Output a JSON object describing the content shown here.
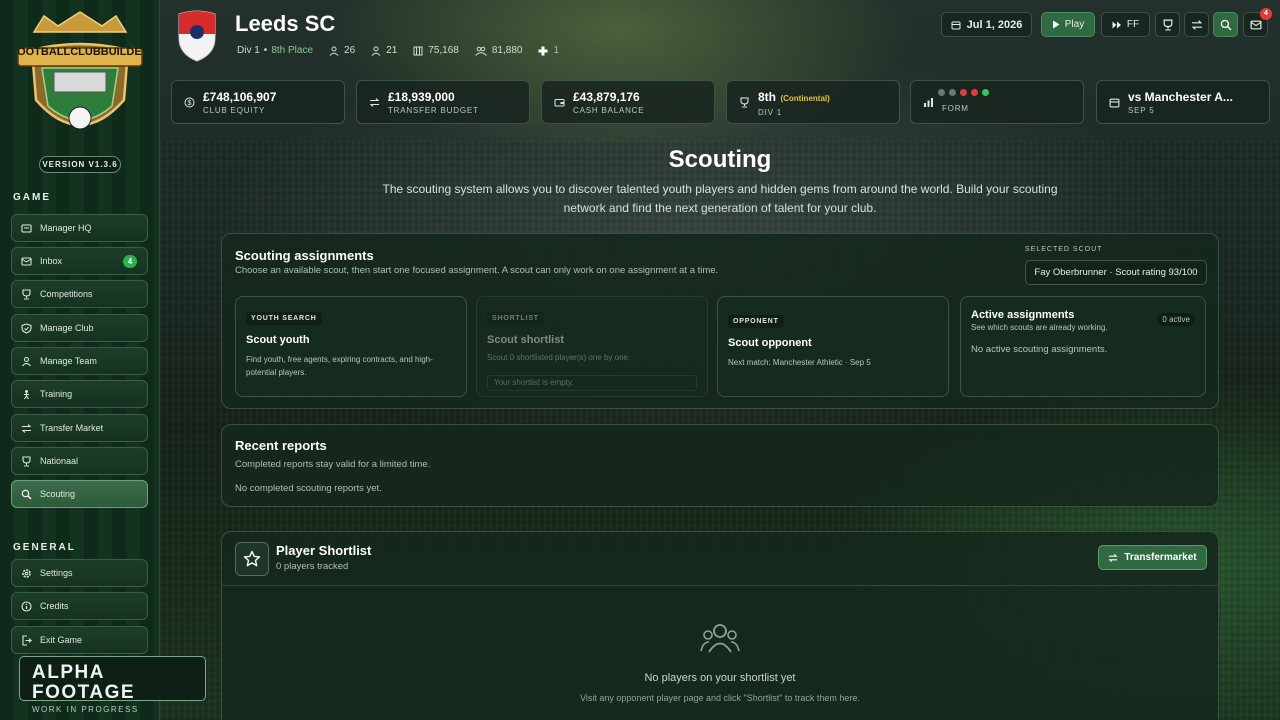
{
  "sidebar": {
    "brand": "FOOTBALLCLUBBUILDER",
    "version": "VERSION V1.3.6",
    "sections": {
      "game": "GAME",
      "general": "GENERAL"
    },
    "game_items": [
      {
        "label": "Manager HQ",
        "icon": "manager-hq-icon"
      },
      {
        "label": "Inbox",
        "icon": "inbox-icon",
        "badge": "4"
      },
      {
        "label": "Competitions",
        "icon": "trophy-icon"
      },
      {
        "label": "Manage Club",
        "icon": "shield-icon"
      },
      {
        "label": "Manage Team",
        "icon": "team-icon"
      },
      {
        "label": "Training",
        "icon": "training-icon"
      },
      {
        "label": "Transfer Market",
        "icon": "transfer-icon"
      },
      {
        "label": "Nationaal",
        "icon": "trophy-icon"
      },
      {
        "label": "Scouting",
        "icon": "search-icon",
        "active": true
      }
    ],
    "general_items": [
      {
        "label": "Settings",
        "icon": "gear-icon"
      },
      {
        "label": "Credits",
        "icon": "info-icon"
      },
      {
        "label": "Exit Game",
        "icon": "exit-icon"
      }
    ],
    "alpha": {
      "title": "ALPHA FOOTAGE",
      "subtitle": "WORK IN PROGRESS"
    }
  },
  "club": {
    "name": "Leeds SC",
    "division": "Div 1",
    "place": "8th Place",
    "stats": {
      "squad": "26",
      "staff": "21",
      "stadium": "75,168",
      "fans": "81,880",
      "medical": "1"
    }
  },
  "header": {
    "date": "Jul 1, 2026",
    "play_label": "Play",
    "ff_label": "FF",
    "mail_badge": "4"
  },
  "stats": [
    {
      "value": "£748,106,907",
      "label": "CLUB EQUITY",
      "icon": "coin-icon"
    },
    {
      "value": "£18,939,000",
      "label": "TRANSFER BUDGET",
      "icon": "transfer-icon"
    },
    {
      "value": "£43,879,176",
      "label": "CASH BALANCE",
      "icon": "wallet-icon"
    },
    {
      "value": "8th",
      "extra": "(Continental)",
      "label": "DIV 1",
      "icon": "trophy-icon"
    },
    {
      "value": "",
      "label": "FORM",
      "icon": "chart-icon",
      "form": [
        "#6b7a70",
        "#6b7a70",
        "#e53b3b",
        "#e53b3b",
        "#2fc85a"
      ]
    },
    {
      "value": "vs Manchester A...",
      "label": "SEP 5",
      "icon": "calendar-icon"
    }
  ],
  "page": {
    "title": "Scouting",
    "description": "The scouting system allows you to discover talented youth players and hidden gems from around the world. Build your scouting network and find the next generation of talent for your club."
  },
  "assignments": {
    "title": "Scouting assignments",
    "subtitle": "Choose an available scout, then start one focused assignment. A scout can only work on one assignment at a time.",
    "selected_scout_label": "SELECTED SCOUT",
    "selected_scout": "Fay Oberbrunner · Scout rating 93/100",
    "cards": {
      "youth": {
        "tag": "YOUTH SEARCH",
        "title": "Scout youth",
        "text": "Find youth, free agents, expiring contracts, and high-potential players."
      },
      "shortlist": {
        "tag": "SHORTLIST",
        "title": "Scout shortlist",
        "text": "Scout 0 shortlisted player(s) one by one.",
        "empty": "Your shortlist is empty."
      },
      "opponent": {
        "tag": "OPPONENT",
        "title": "Scout opponent",
        "text": "Next match: Manchester Athletic · Sep 5"
      },
      "active": {
        "title": "Active assignments",
        "subtitle": "See which scouts are already working.",
        "pill": "0 active",
        "empty": "No active scouting assignments."
      }
    }
  },
  "reports": {
    "title": "Recent reports",
    "subtitle": "Completed reports stay valid for a limited time.",
    "empty": "No completed scouting reports yet."
  },
  "shortlist": {
    "title": "Player Shortlist",
    "subtitle": "0 players tracked",
    "button": "Transfermarket",
    "empty_title": "No players on your shortlist yet",
    "empty_text": "Visit any opponent player page and click \"Shortlist\" to track them here."
  }
}
